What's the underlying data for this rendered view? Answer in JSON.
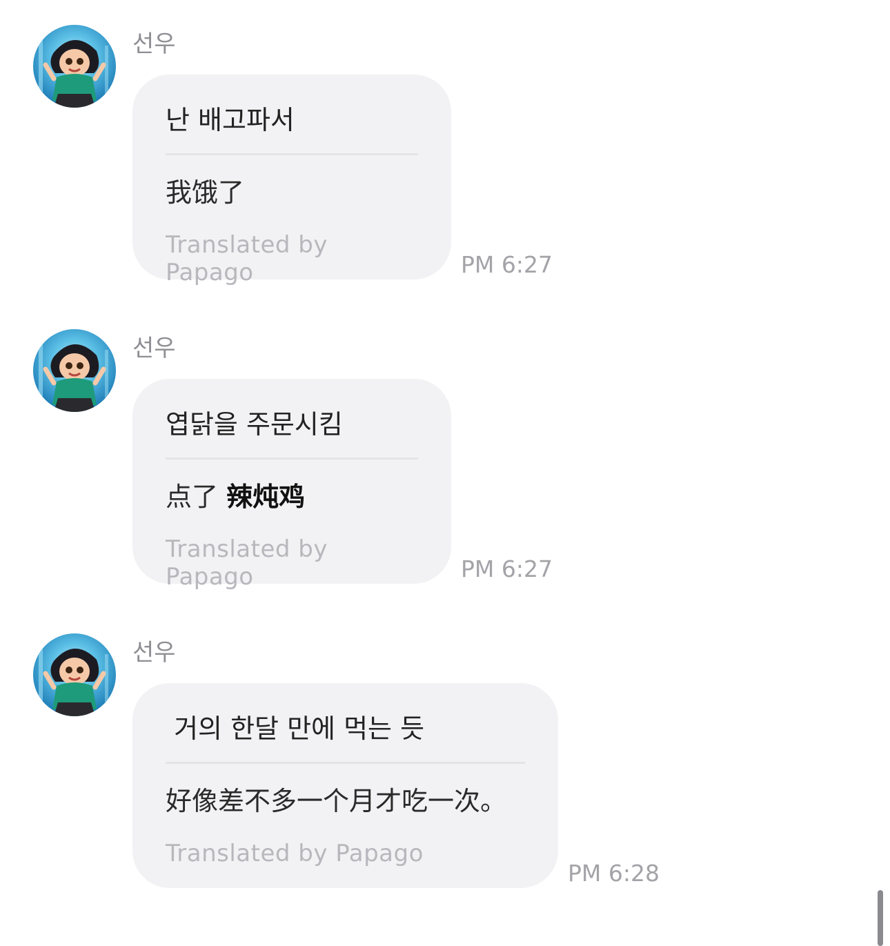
{
  "messages": [
    {
      "sender": "선우",
      "original": "난 배고파서",
      "translation": "我饿了",
      "credit": "Translated by Papago",
      "time": "PM 6:27"
    },
    {
      "sender": "선우",
      "original": "엽닭을 주문시킴",
      "translation_prefix": "点了 ",
      "translation_bold": "辣炖鸡",
      "credit": "Translated by Papago",
      "time": "PM 6:27"
    },
    {
      "sender": "선우",
      "original": " 거의 한달 만에 먹는 듯",
      "translation": "好像差不多一个月才吃一次。",
      "credit": "Translated by Papago",
      "time": "PM 6:28"
    }
  ],
  "colors": {
    "bubble": "#f2f2f4",
    "sender": "#8e8e93",
    "credit": "#b7b7bd",
    "time": "#a3a3a8"
  },
  "icons": {
    "avatar": "profile-avatar-icon"
  }
}
